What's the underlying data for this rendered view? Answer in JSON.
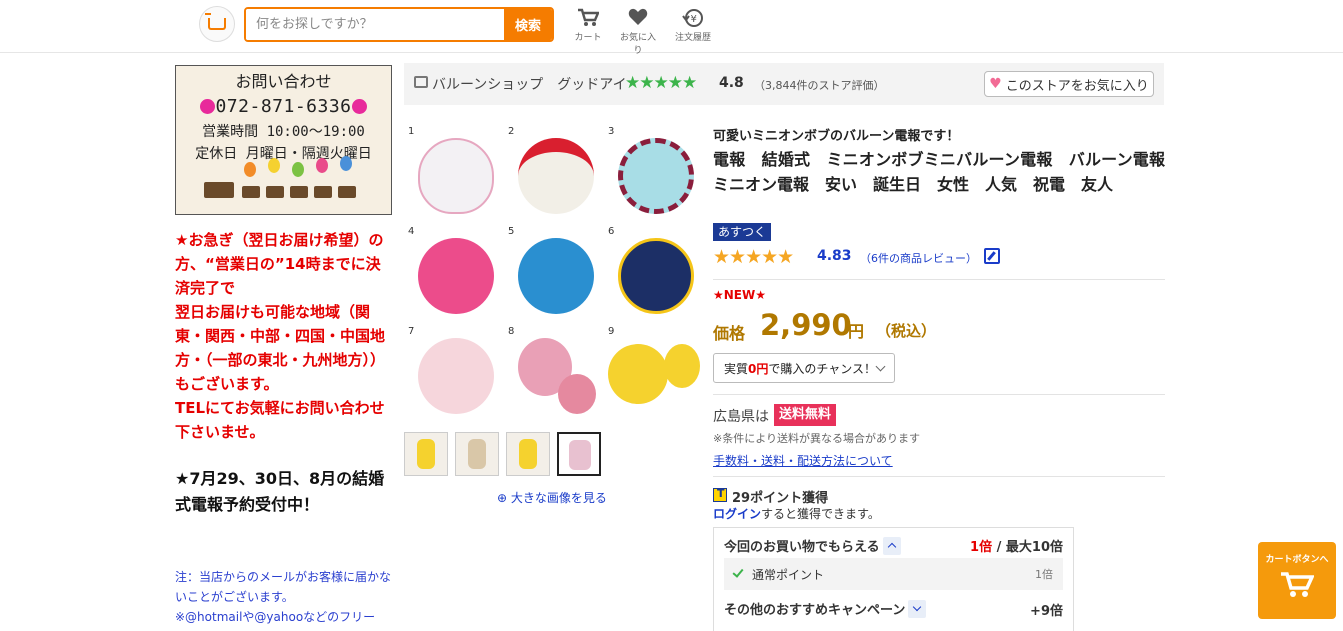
{
  "header": {
    "search_placeholder": "何をお探しですか？",
    "search_button": "検索",
    "nav": [
      {
        "label": "カート",
        "icon": "cart-icon"
      },
      {
        "label": "お気に入り",
        "icon": "heart-icon"
      },
      {
        "label": "注文履歴",
        "icon": "order-history-icon"
      }
    ]
  },
  "contact_banner": {
    "title": "お問い合わせ",
    "phone": "072-871-6336",
    "hours": "営業時間 10:00～19:00",
    "closed": "定休日 月曜日・隔週火曜日"
  },
  "left": {
    "red_notice": "★お急ぎ（翌日お届け希望）の方、“営業日の”14時までに決済完了で\n翌日お届けも可能な地域（関東・関西・中部・四国・中国地方・（一部の東北・九州地方））もございます。\nTELにてお気軽にお問い合わせ下さいませ。",
    "event_notice": "★7月29、30日、8月の結婚式電報予約受付中！",
    "mail_note": "注：当店からのメールがお客様に届かないことがございます。\n※@hotmailや@yahooなどのフリー"
  },
  "store": {
    "name": "バルーンショップ　グッドアイ",
    "stars": "★★★★★",
    "rating": "4.8",
    "review_count": "（3,844件のストア評価）",
    "favorite_button": "このストアをお気に入り",
    "accent_color": "#3cb44b"
  },
  "gallery": {
    "numbers": [
      "1",
      "2",
      "3",
      "4",
      "5",
      "6",
      "7",
      "8",
      "9"
    ],
    "zoom_link": "大きな画像を見る"
  },
  "product": {
    "catchcopy": "可愛いミニオンボブのバルーン電報です！",
    "title": "電報　結婚式　ミニオンボブミニバルーン電報　バルーン電報　ミニオン電報　安い　誕生日　女性　人気　祝電　友人",
    "badge": "あすつく",
    "review_stars": "★★★★★",
    "review_rating": "4.83",
    "review_count": "（6件の商品レビュー）",
    "new_badge": "★NEW★",
    "price_label": "価格",
    "price": "2,990",
    "price_unit": "円",
    "price_tax": "（税込）",
    "chance_button_prefix": "実質",
    "chance_button_zero": "0円",
    "chance_button_suffix": "で購入のチャンス！",
    "ship_region": "広島県は",
    "free_shipping": "送料無料",
    "ship_note": "※条件により送料が異なる場合があります",
    "fee_link": "手数料・送料・配送方法について",
    "price_color": "#b07800"
  },
  "points": {
    "earned": "29ポイント獲得",
    "login_link": "ログイン",
    "login_text": "すると獲得できます。",
    "row1_label": "今回のお買い物でもらえる",
    "row1_rate_red": "1倍",
    "row1_rate_rest": " / 最大10倍",
    "normal_label": "通常ポイント",
    "normal_value": "1倍",
    "campaign_label": "その他のおすすめキャンペーン",
    "campaign_value": "+9倍"
  },
  "cart_float": {
    "label": "カートボタンへ"
  }
}
